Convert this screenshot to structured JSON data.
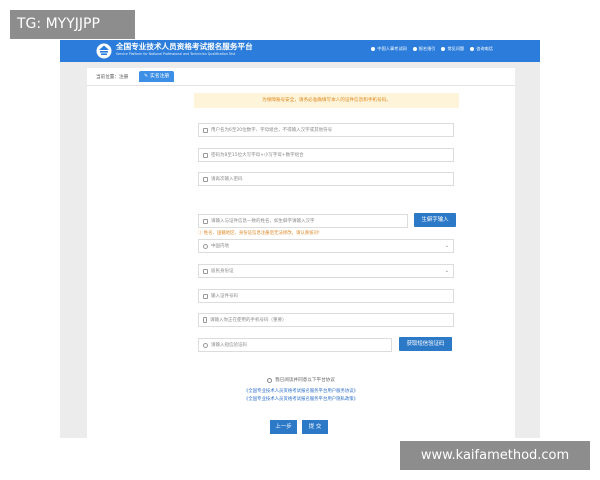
{
  "watermark_top": "TG: MYYJJPP",
  "watermark_bottom": "www.kaifamethod.com",
  "header": {
    "title": "全国专业技术人员资格考试报名服务平台",
    "subtitle": "Service Platform for National Professional and Technician Qualification Test",
    "links": [
      "中国人事考试网",
      "报名指引",
      "常见问题",
      "咨询电话"
    ]
  },
  "breadcrumb": {
    "label": "当前位置：注册",
    "tab": "实名注册"
  },
  "notice": "为保障账号安全，请务必准确填写本人的证件信息和手机号码。",
  "fields": {
    "username": "用户名为6至20位数字、字母组合，不得输入汉字或其他符号",
    "password": "密码为8至15位大写字母+小写字母+数字组合",
    "password_confirm": "请再次输入密码",
    "name": "请输入与证件信息一致的姓名，如生僻字请输入汉字",
    "region": "中国内地",
    "id_type": "居民身份证",
    "id_number": "输入证件号码",
    "phone": "请输入你正在使用的手机号码（重要）",
    "sms_code": "请输入短信验证码"
  },
  "hint": "姓名、国籍地区、身份证信息注册后无法修改，请认真核对!",
  "buttons": {
    "rare_char": "生僻字输入",
    "get_code": "获取短信验证码",
    "prev": "上一步",
    "submit": "提 交"
  },
  "agreement": {
    "text": "我已阅读并同意以下平台协议",
    "link1": "《全国专业技术人员资格考试报名服务平台用户服务协议》",
    "link2": "《全国专业技术人员资格考试报名服务平台用户隐私政策》"
  },
  "colors": {
    "header_blue": "#2c7ddb",
    "button_blue": "#2c79c8",
    "notice_bg": "#fdf4da",
    "notice_text": "#e0861c"
  }
}
